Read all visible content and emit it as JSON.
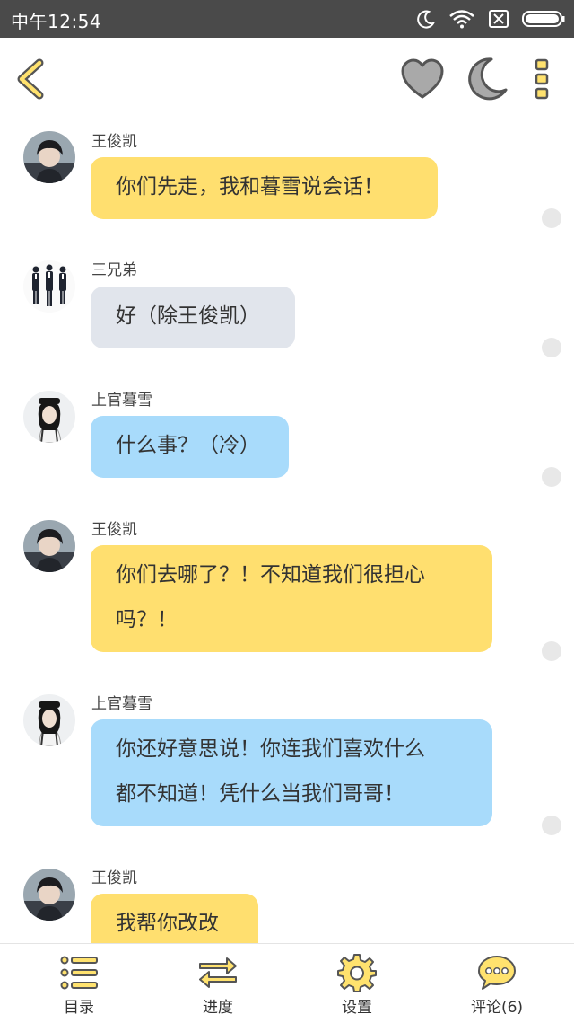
{
  "status_bar": {
    "time": "中午12:54"
  },
  "header": {
    "back": "back-icon",
    "favorite": "heart-icon",
    "night_mode": "moon-icon",
    "more": "more-icon"
  },
  "messages": [
    {
      "sender": "王俊凯",
      "text": "你们先走，我和暮雪说会话！",
      "bubble_color": "#ffdf6f",
      "avatar": "boy-portrait"
    },
    {
      "sender": "三兄弟",
      "text": "好（除王俊凯）",
      "bubble_color": "#e1e5ec",
      "avatar": "three-men-in-suits"
    },
    {
      "sender": "上官暮雪",
      "text": "什么事？（冷）",
      "bubble_color": "#a8dbfb",
      "avatar": "girl-portrait"
    },
    {
      "sender": "王俊凯",
      "lines": [
        "你们去哪了？！不知道我们很担心",
        "吗？！"
      ],
      "bubble_color": "#ffdf6f",
      "avatar": "boy-portrait"
    },
    {
      "sender": "上官暮雪",
      "lines": [
        "你还好意思说！你连我们喜欢什么",
        "都不知道！凭什么当我们哥哥！"
      ],
      "bubble_color": "#a8dbfb",
      "avatar": "girl-portrait"
    },
    {
      "sender": "王俊凯",
      "text": "我帮你改改",
      "bubble_color": "#ffdf6f",
      "avatar": "boy-portrait"
    }
  ],
  "bottom_nav": [
    {
      "label": "目录",
      "icon": "list-icon"
    },
    {
      "label": "进度",
      "icon": "swap-arrows-icon"
    },
    {
      "label": "设置",
      "icon": "gear-icon"
    },
    {
      "label": "评论(6)",
      "icon": "comment-bubble-icon"
    }
  ],
  "colors": {
    "accent_yellow": "#ffdf6f",
    "accent_blue": "#a8dbfb",
    "neutral_bubble": "#e1e5ec",
    "status_bar": "#4a4a4a"
  }
}
